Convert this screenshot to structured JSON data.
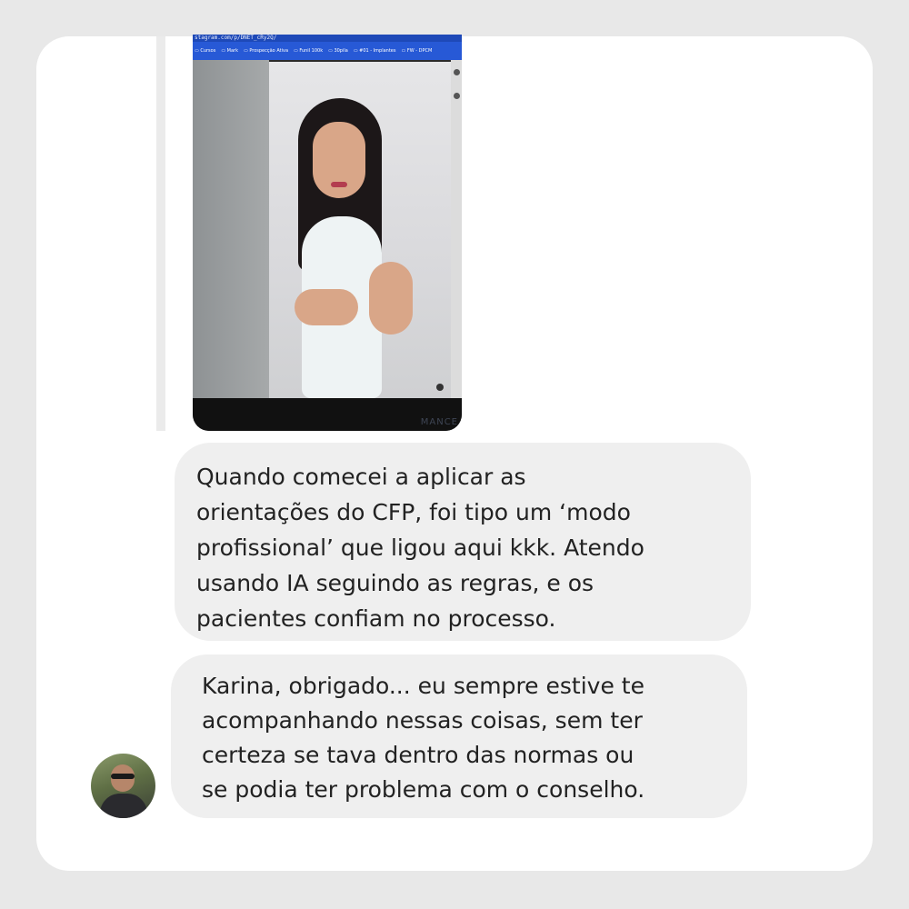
{
  "browser": {
    "url": "stagram.com/p/DNET_cRy2Q/",
    "bookmarks": [
      "Cursos",
      "Mark",
      "Prospecção Ativa",
      "Funil 100k",
      "30pila",
      "#01 - Implantes",
      "FW - DPCM"
    ]
  },
  "video_watermark": "MANCE",
  "messages": [
    {
      "sender": "other",
      "lines": [
        "Quando comecei a aplicar as",
        "orientações do CFP, foi tipo um ‘modo",
        "profissional’ que ligou aqui kkk. Atendo",
        "usando IA seguindo as regras, e os",
        "pacientes confiam no processo."
      ]
    },
    {
      "sender": "self",
      "lines": [
        "Karina, obrigado... eu sempre estive te",
        "acompanhando nessas coisas, sem ter",
        "certeza se tava dentro das normas ou",
        "se podia ter problema com o conselho."
      ]
    }
  ],
  "colors": {
    "background": "#e8e8e8",
    "card": "#ffffff",
    "bubble": "#efefef",
    "text": "#222222",
    "browser_bar": "#2759d6"
  }
}
